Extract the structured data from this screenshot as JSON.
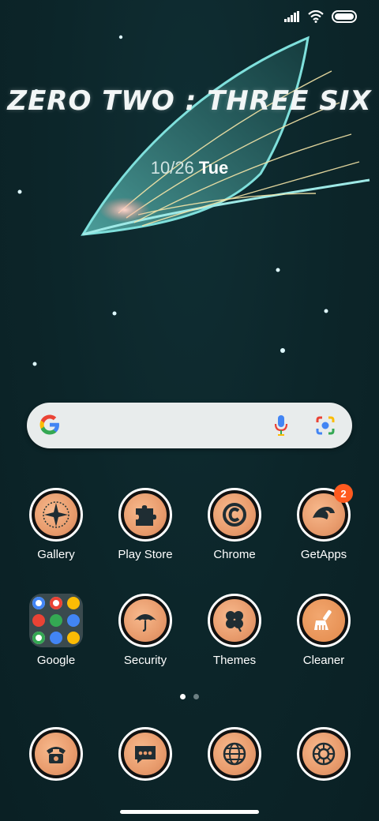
{
  "status_bar": {
    "signal_icon": "signal-icon",
    "wifi_icon": "wifi-icon",
    "battery_icon": "battery-icon"
  },
  "wallpaper": {
    "clock_text": "ZERO TWO : THREE SIX",
    "date": "10/26",
    "weekday": "Tue",
    "accent": "#6fd2cf"
  },
  "search": {
    "google_icon": "google-g-icon",
    "mic_icon": "mic-icon",
    "lens_icon": "lens-icon"
  },
  "apps_row1": [
    {
      "label": "Gallery",
      "icon": "compass-icon"
    },
    {
      "label": "Play Store",
      "icon": "puzzle-icon"
    },
    {
      "label": "Chrome",
      "icon": "copyright-icon"
    },
    {
      "label": "GetApps",
      "icon": "bird-icon",
      "badge": "2"
    }
  ],
  "apps_row2": [
    {
      "label": "Google",
      "icon": "folder-icon"
    },
    {
      "label": "Security",
      "icon": "umbrella-icon"
    },
    {
      "label": "Themes",
      "icon": "clover-icon"
    },
    {
      "label": "Cleaner",
      "icon": "broom-icon"
    }
  ],
  "dock": [
    {
      "icon": "phone-icon"
    },
    {
      "icon": "message-icon"
    },
    {
      "icon": "globe-icon"
    },
    {
      "icon": "camera-aperture-icon"
    }
  ],
  "pager": {
    "pages": 2,
    "active": 1
  },
  "colors": {
    "badge": "#ff5a1f",
    "icon_ring": "#ffffff",
    "icon_face": "#e89b6c"
  }
}
